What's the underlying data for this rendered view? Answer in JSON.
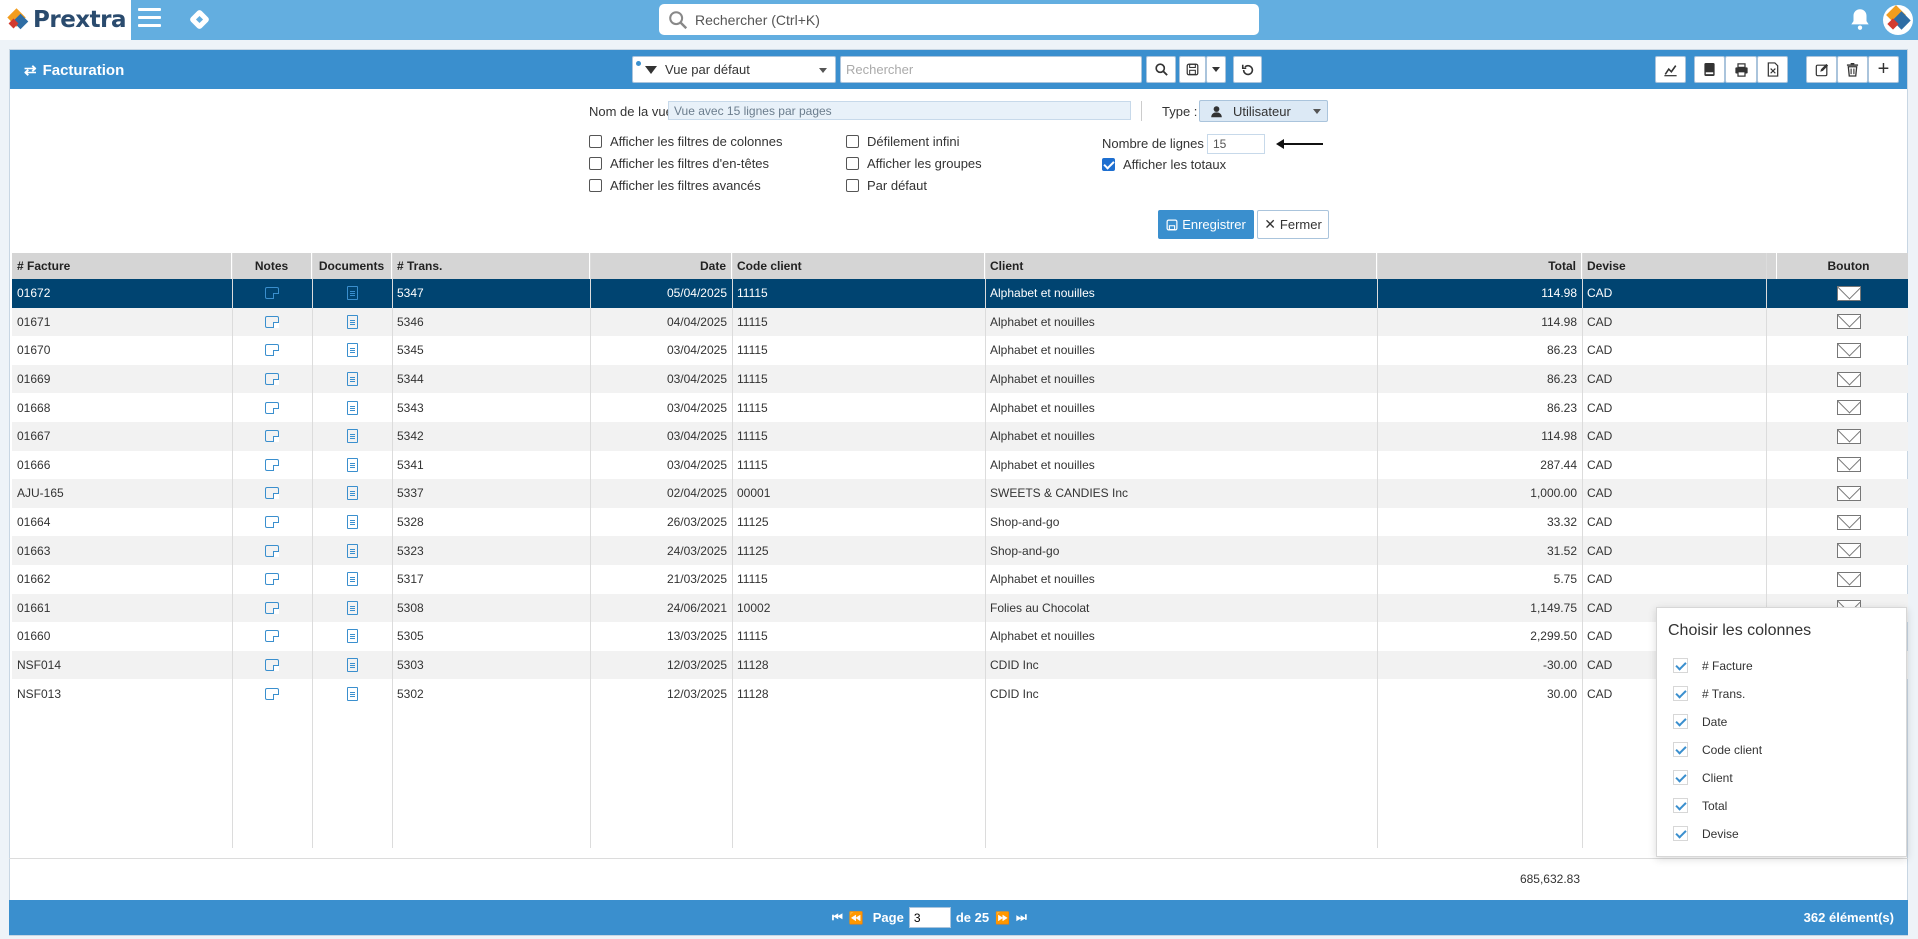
{
  "app": {
    "name": "Prextra"
  },
  "topbar": {
    "search_placeholder": "Rechercher (Ctrl+K)"
  },
  "panel": {
    "title": "Facturation",
    "view_select": "Vue par défaut",
    "search_placeholder": "Rechercher"
  },
  "view_settings": {
    "name_label": "Nom de la vue :",
    "name_value": "Vue avec 15 lignes par pages",
    "type_label": "Type :",
    "type_value": "Utilisateur",
    "options": [
      {
        "label": "Afficher les filtres de colonnes",
        "checked": false
      },
      {
        "label": "Afficher les filtres d'en-têtes",
        "checked": false
      },
      {
        "label": "Afficher les filtres avancés",
        "checked": false
      },
      {
        "label": "Défilement infini",
        "checked": false
      },
      {
        "label": "Afficher les groupes",
        "checked": false
      },
      {
        "label": "Par défaut",
        "checked": false
      }
    ],
    "rows_label": "Nombre de lignes :",
    "rows_value": "15",
    "totals_label": "Afficher les totaux",
    "totals_checked": true,
    "save_label": "Enregistrer",
    "close_label": "Fermer"
  },
  "grid": {
    "columns": [
      "# Facture",
      "Notes",
      "Documents",
      "# Trans.",
      "Date",
      "Code client",
      "Client",
      "Total",
      "Devise",
      "Bouton"
    ],
    "rows": [
      [
        "01672",
        "5347",
        "05/04/2025",
        "11115",
        "Alphabet et nouilles",
        "114.98",
        "CAD"
      ],
      [
        "01671",
        "5346",
        "04/04/2025",
        "11115",
        "Alphabet et nouilles",
        "114.98",
        "CAD"
      ],
      [
        "01670",
        "5345",
        "03/04/2025",
        "11115",
        "Alphabet et nouilles",
        "86.23",
        "CAD"
      ],
      [
        "01669",
        "5344",
        "03/04/2025",
        "11115",
        "Alphabet et nouilles",
        "86.23",
        "CAD"
      ],
      [
        "01668",
        "5343",
        "03/04/2025",
        "11115",
        "Alphabet et nouilles",
        "86.23",
        "CAD"
      ],
      [
        "01667",
        "5342",
        "03/04/2025",
        "11115",
        "Alphabet et nouilles",
        "114.98",
        "CAD"
      ],
      [
        "01666",
        "5341",
        "03/04/2025",
        "11115",
        "Alphabet et nouilles",
        "287.44",
        "CAD"
      ],
      [
        "AJU-165",
        "5337",
        "02/04/2025",
        "00001",
        "SWEETS & CANDIES Inc",
        "1,000.00",
        "CAD"
      ],
      [
        "01664",
        "5328",
        "26/03/2025",
        "11125",
        "Shop-and-go",
        "33.32",
        "CAD"
      ],
      [
        "01663",
        "5323",
        "24/03/2025",
        "11125",
        "Shop-and-go",
        "31.52",
        "CAD"
      ],
      [
        "01662",
        "5317",
        "21/03/2025",
        "11115",
        "Alphabet et nouilles",
        "5.75",
        "CAD"
      ],
      [
        "01661",
        "5308",
        "24/06/2021",
        "10002",
        "Folies au Chocolat",
        "1,149.75",
        "CAD"
      ],
      [
        "01660",
        "5305",
        "13/03/2025",
        "11115",
        "Alphabet et nouilles",
        "2,299.50",
        "CAD"
      ],
      [
        "NSF014",
        "5303",
        "12/03/2025",
        "11128",
        "CDID Inc",
        "-30.00",
        "CAD"
      ],
      [
        "NSF013",
        "5302",
        "12/03/2025",
        "11128",
        "CDID Inc",
        "30.00",
        "CAD"
      ]
    ],
    "selected_row": 0,
    "total": "685,632.83"
  },
  "pager": {
    "page_label": "Page",
    "page_value": "3",
    "of_label": "de 25",
    "count": "362 élément(s)"
  },
  "column_chooser": {
    "title": "Choisir les colonnes",
    "items": [
      "# Facture",
      "# Trans.",
      "Date",
      "Code client",
      "Client",
      "Total",
      "Devise"
    ]
  },
  "colors": {
    "topbar": "#63aee0",
    "header": "#3a8fce",
    "selected_row": "#004471"
  }
}
